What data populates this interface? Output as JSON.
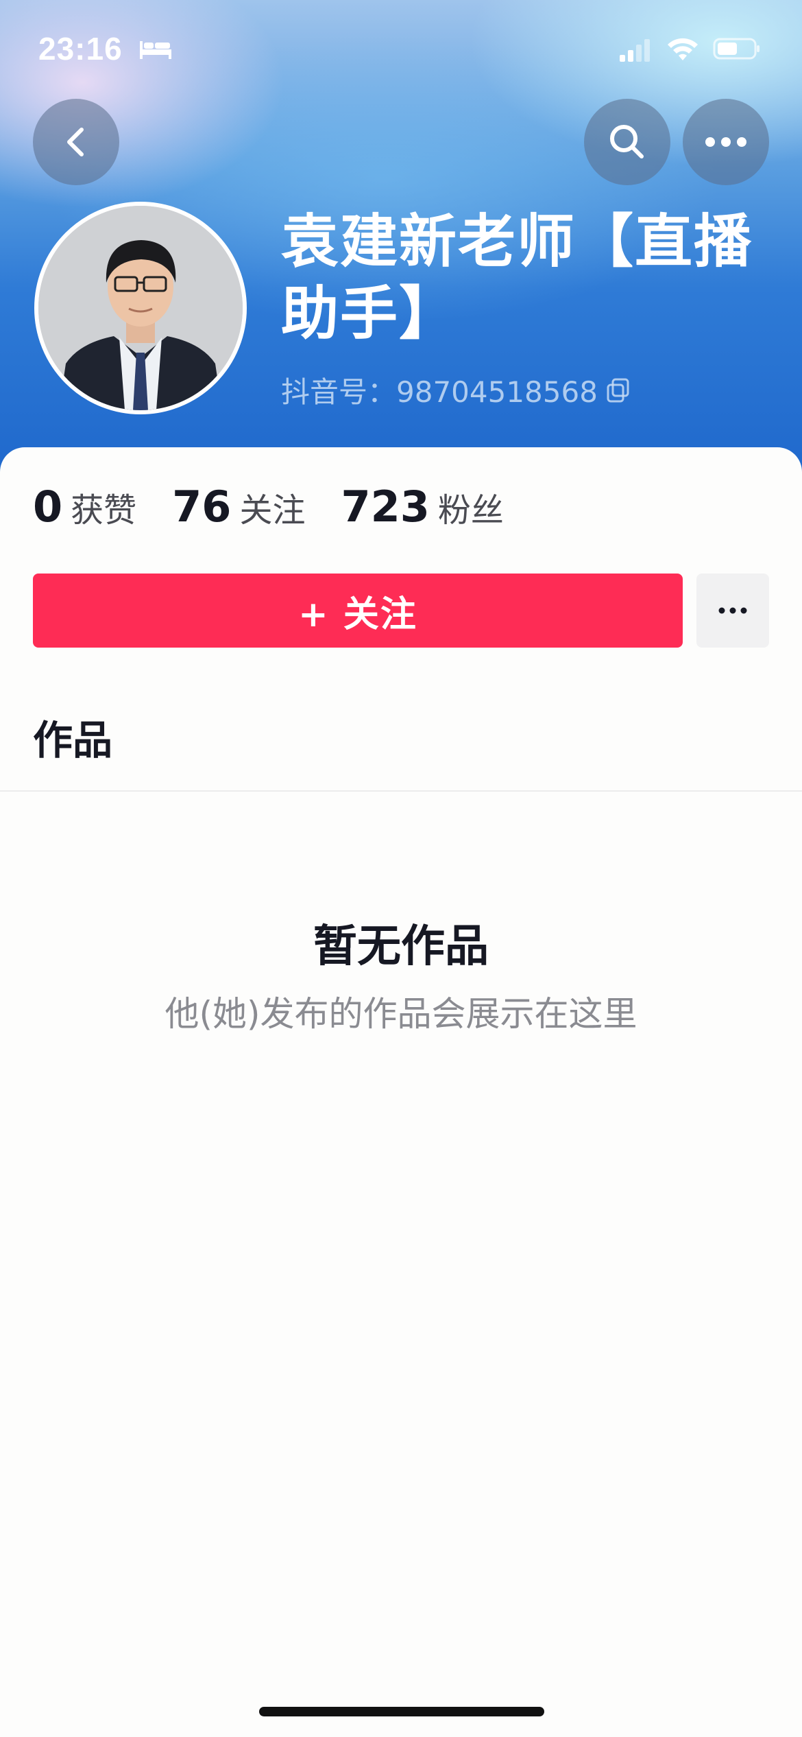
{
  "status_bar": {
    "time": "23:16",
    "icons": [
      "bed-icon",
      "signal-icon",
      "wifi-icon",
      "battery-icon"
    ]
  },
  "nav": {
    "back_icon": "chevron-left-icon",
    "search_icon": "search-icon",
    "more_icon": "more-horizontal-icon"
  },
  "profile": {
    "name": "袁建新老师【直播助手】",
    "douyin_id": "抖音号：98704518568",
    "copy_icon": "copy-icon"
  },
  "stats": [
    {
      "value": "0",
      "label": "获赞"
    },
    {
      "value": "76",
      "label": "关注"
    },
    {
      "value": "723",
      "label": "粉丝"
    }
  ],
  "actions": {
    "follow_label": "+ 关注",
    "more_icon": "more-horizontal-icon"
  },
  "tabs": {
    "works": "作品"
  },
  "empty_state": {
    "title": "暂无作品",
    "description": "他(她)发布的作品会展示在这里"
  },
  "colors": {
    "accent": "#fe2c55",
    "header_blue": "#2f7bd6"
  }
}
